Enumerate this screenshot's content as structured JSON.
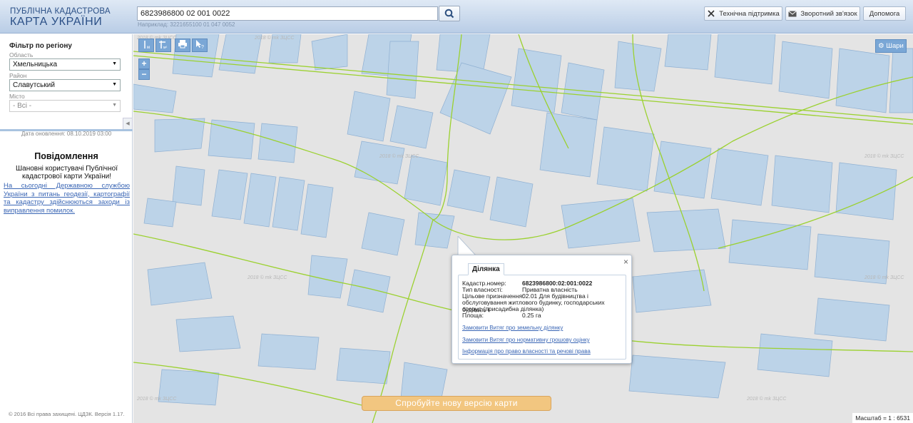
{
  "header": {
    "logo_line1": "ПУБЛІЧНА КАДАСТРОВА",
    "logo_line2": "КАРТА УКРАЇНИ",
    "search_value": "6823986800 02 001 0022",
    "search_hint": "Наприклад: 3221655100 01 047 0052",
    "buttons": {
      "support": "Технічна підтримка",
      "feedback": "Зворотний зв'язок",
      "help": "Допомога"
    }
  },
  "sidebar": {
    "filter_title": "Фільтр по регіону",
    "region_label": "Область",
    "region_value": "Хмельницька",
    "district_label": "Район",
    "district_value": "Славутський",
    "city_label": "Місто",
    "city_value": "- Всі -",
    "update_date": "Дата оновлення: 08.10.2019 03:00",
    "message_title": "Повідомлення",
    "message_text": "Шановні користувачі Публічної кадастрової карти України!",
    "message_link": "На сьогодні Державною службою України з питань геодезії, картографії та кадастру здійснюються заходи із виправлення помилок.",
    "copyright": "© 2016 Всі права захищені. ЦДЗК. Версія 1.17."
  },
  "map": {
    "layers_label": "Шари",
    "zoom_in": "+",
    "zoom_out": "−",
    "watermark": "2018 © mk ЗЦСС",
    "try_new": "Спробуйте нову версію карти",
    "scale": "Масштаб = 1 : 6531",
    "colors": {
      "parcel": "#bcd3e8",
      "road": "#9bd12f",
      "background": "#e4e4e4",
      "accent": "#7aa7d6"
    }
  },
  "popup": {
    "tab": "Ділянка",
    "close": "×",
    "cadastral_label": "Кадастр.номер:",
    "cadastral_value": "6823986800:02:001:0022",
    "ownership_label": "Тип власності:",
    "ownership_value": "Приватна власність",
    "purpose_label": "Цільове призначення:",
    "purpose_value": "02.01 Для будівництва і",
    "purpose_cont1": "обслуговування житлового будинку, господарських будівель і",
    "purpose_cont2": "споруд (присадибна ділянка)",
    "area_label": "Площа:",
    "area_value": "0.25 га",
    "link1": "Замовити Витяг про земельну ділянку",
    "link2": "Замовити Витяг про нормативну грошову оцінку",
    "link3": "Інформація про право власності та речові права"
  }
}
